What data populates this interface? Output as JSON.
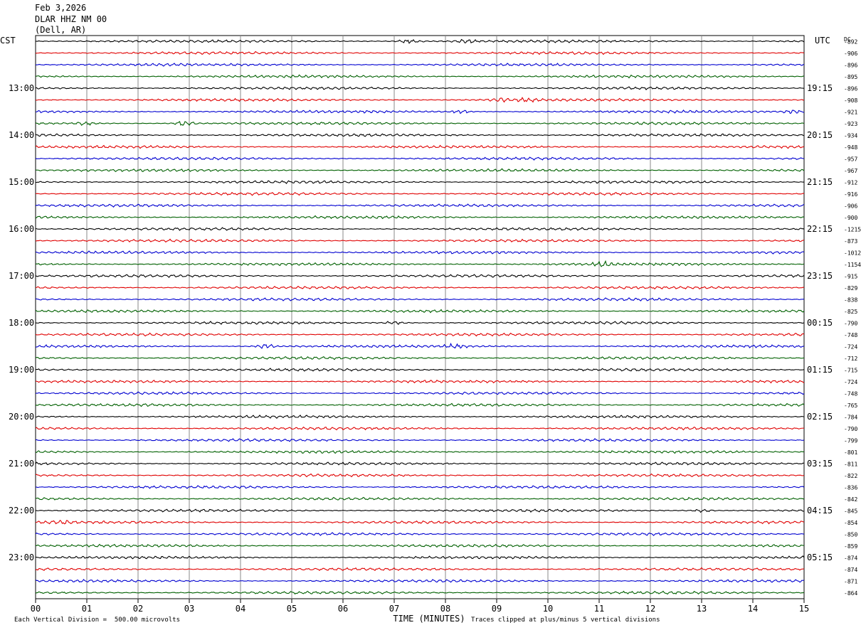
{
  "header": {
    "date": "Feb 3,2026",
    "station": "DLAR HHZ NM 00",
    "location": "(Dell, AR)"
  },
  "chart_data": {
    "type": "line",
    "left_zone_label": "CST",
    "right_zone_label": "UTC",
    "dc_label": "DC",
    "xlabel": "TIME (MINUTES)",
    "xlim": [
      0,
      15
    ],
    "x_ticks": [
      "00",
      "01",
      "02",
      "03",
      "04",
      "05",
      "06",
      "07",
      "08",
      "09",
      "10",
      "11",
      "12",
      "13",
      "14",
      "15"
    ],
    "trace_colors": [
      "#000000",
      "#e00000",
      "#0000d0",
      "#006000"
    ],
    "rows_per_hour": 4,
    "left_hour_labels": [
      "13:00",
      "14:00",
      "15:00",
      "16:00",
      "17:00",
      "18:00",
      "19:00",
      "20:00",
      "21:00",
      "22:00",
      "23:00"
    ],
    "right_hour_labels": [
      "19:15",
      "20:15",
      "21:15",
      "22:15",
      "23:15",
      "00:15",
      "01:15",
      "02:15",
      "03:15",
      "04:15",
      "05:15"
    ],
    "first_labeled_row": 4,
    "dc_offsets": [
      "-892",
      "-906",
      "-896",
      "-895",
      "-896",
      "-908",
      "-921",
      "-923",
      "-934",
      "-948",
      "-957",
      "-967",
      "-912",
      "-916",
      "-906",
      "-900",
      "-1215",
      "-873",
      "-1012",
      "-1154",
      "-915",
      "-829",
      "-838",
      "-825",
      "-790",
      "-748",
      "-724",
      "-712",
      "-715",
      "-724",
      "-748",
      "-765",
      "-784",
      "-790",
      "-799",
      "-801",
      "-811",
      "-822",
      "-836",
      "-842",
      "-845",
      "-854",
      "-850",
      "-859",
      "-874",
      "-874",
      "-871",
      "-864"
    ],
    "amplitude_scale": "Each Vertical Division =  500.00 microvolts",
    "clip_note": "Traces clipped at plus/minus 5 vertical divisions",
    "events": [
      {
        "row": 0,
        "minute": 7.3,
        "amp": 2.5
      },
      {
        "row": 0,
        "minute": 8.4,
        "amp": 2.2
      },
      {
        "row": 5,
        "minute": 9.1,
        "amp": 2.5
      },
      {
        "row": 5,
        "minute": 9.6,
        "amp": 2.0
      },
      {
        "row": 6,
        "minute": 8.3,
        "amp": 1.8
      },
      {
        "row": 6,
        "minute": 14.8,
        "amp": 1.8
      },
      {
        "row": 7,
        "minute": 2.9,
        "amp": 3.0
      },
      {
        "row": 7,
        "minute": 1.0,
        "amp": 1.8
      },
      {
        "row": 19,
        "minute": 11.1,
        "amp": 2.5
      },
      {
        "row": 24,
        "minute": 7.0,
        "amp": 1.8
      },
      {
        "row": 26,
        "minute": 4.5,
        "amp": 2.5
      },
      {
        "row": 26,
        "minute": 8.2,
        "amp": 2.0
      },
      {
        "row": 40,
        "minute": 13.0,
        "amp": 1.8
      },
      {
        "row": 41,
        "minute": 0.5,
        "amp": 1.8
      }
    ]
  }
}
